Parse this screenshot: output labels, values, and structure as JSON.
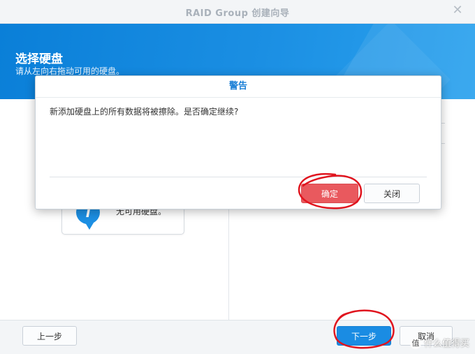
{
  "window": {
    "title": "RAID Group 创建向导",
    "close_icon": "close-icon"
  },
  "header": {
    "title": "选择硬盘",
    "subtitle": "请从左向右拖动可用的硬盘。"
  },
  "left_panel": {
    "empty_message": "无可用硬盘。",
    "icon": "info-icon"
  },
  "footer": {
    "prev_label": "上一步",
    "next_label": "下一步",
    "cancel_label": "取消"
  },
  "dialog": {
    "title": "警告",
    "message": "新添加硬盘上的所有数据将被擦除。是否确定继续?",
    "ok_label": "确定",
    "close_label": "关闭"
  },
  "watermark": {
    "badge": "值",
    "text": "什么值得买"
  },
  "colors": {
    "accent": "#1a8ce3",
    "danger": "#e9595e",
    "annotation": "#e0141e"
  }
}
